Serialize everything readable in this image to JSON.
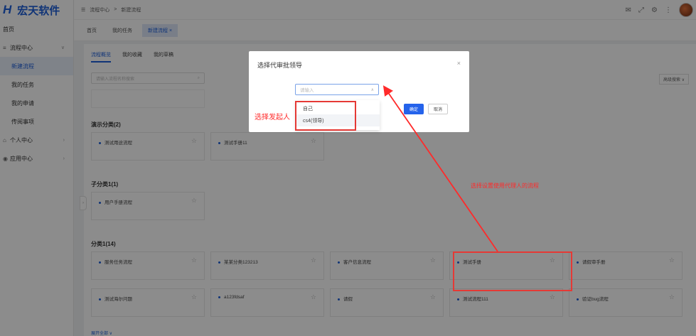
{
  "app": {
    "logo_mark": "H",
    "logo_text": "宏天软件"
  },
  "sidebar": {
    "items": [
      {
        "label": "首页"
      },
      {
        "label": "流程中心",
        "icon": "≡"
      },
      {
        "label": "新建流程"
      },
      {
        "label": "我的任务"
      },
      {
        "label": "我的申请"
      },
      {
        "label": "传阅事项"
      },
      {
        "label": "个人中心",
        "icon": "⌂"
      },
      {
        "label": "应用中心",
        "icon": "◉"
      }
    ]
  },
  "header": {
    "breadcrumb_icon": "☰",
    "crumb1": "流程中心",
    "sep": ">",
    "crumb2": "新建流程"
  },
  "tabs": [
    {
      "label": "首页"
    },
    {
      "label": "我的任务"
    },
    {
      "label": "新建流程 ×"
    }
  ],
  "subtabs": [
    {
      "label": "流程概览"
    },
    {
      "label": "我的收藏"
    },
    {
      "label": "我的草稿"
    }
  ],
  "search": {
    "placeholder": "请输入流程名称搜索",
    "advanced": "高级搜索 ∨"
  },
  "sections": [
    {
      "title": "演示分类(2)",
      "cards": [
        "测试用途流程",
        "测试手册11"
      ]
    },
    {
      "title": "子分类1(1)",
      "cards": [
        "用户手册流程"
      ]
    },
    {
      "title": "分类1(14)",
      "cards": [
        "服务任务流程",
        "某某分类123213",
        "客户信息流程",
        "测试手册",
        "请假审手册",
        "测试海尔问题",
        "a123fdsaf",
        "请假",
        "测试流程111",
        "验证bug流程"
      ]
    }
  ],
  "more_link": "展开全部 ∨",
  "dialog": {
    "title": "选择代审批领导",
    "close": "×",
    "select_placeholder": "请输入",
    "confirm": "确定",
    "cancel": "取消",
    "options": [
      "自己",
      "cs4(领导)"
    ]
  },
  "annotations": {
    "label1": "选择发起人",
    "label2": "选择设置使用代理人的流程"
  },
  "colors": {
    "accent": "#1e5fd9",
    "annotation": "#e53935"
  }
}
